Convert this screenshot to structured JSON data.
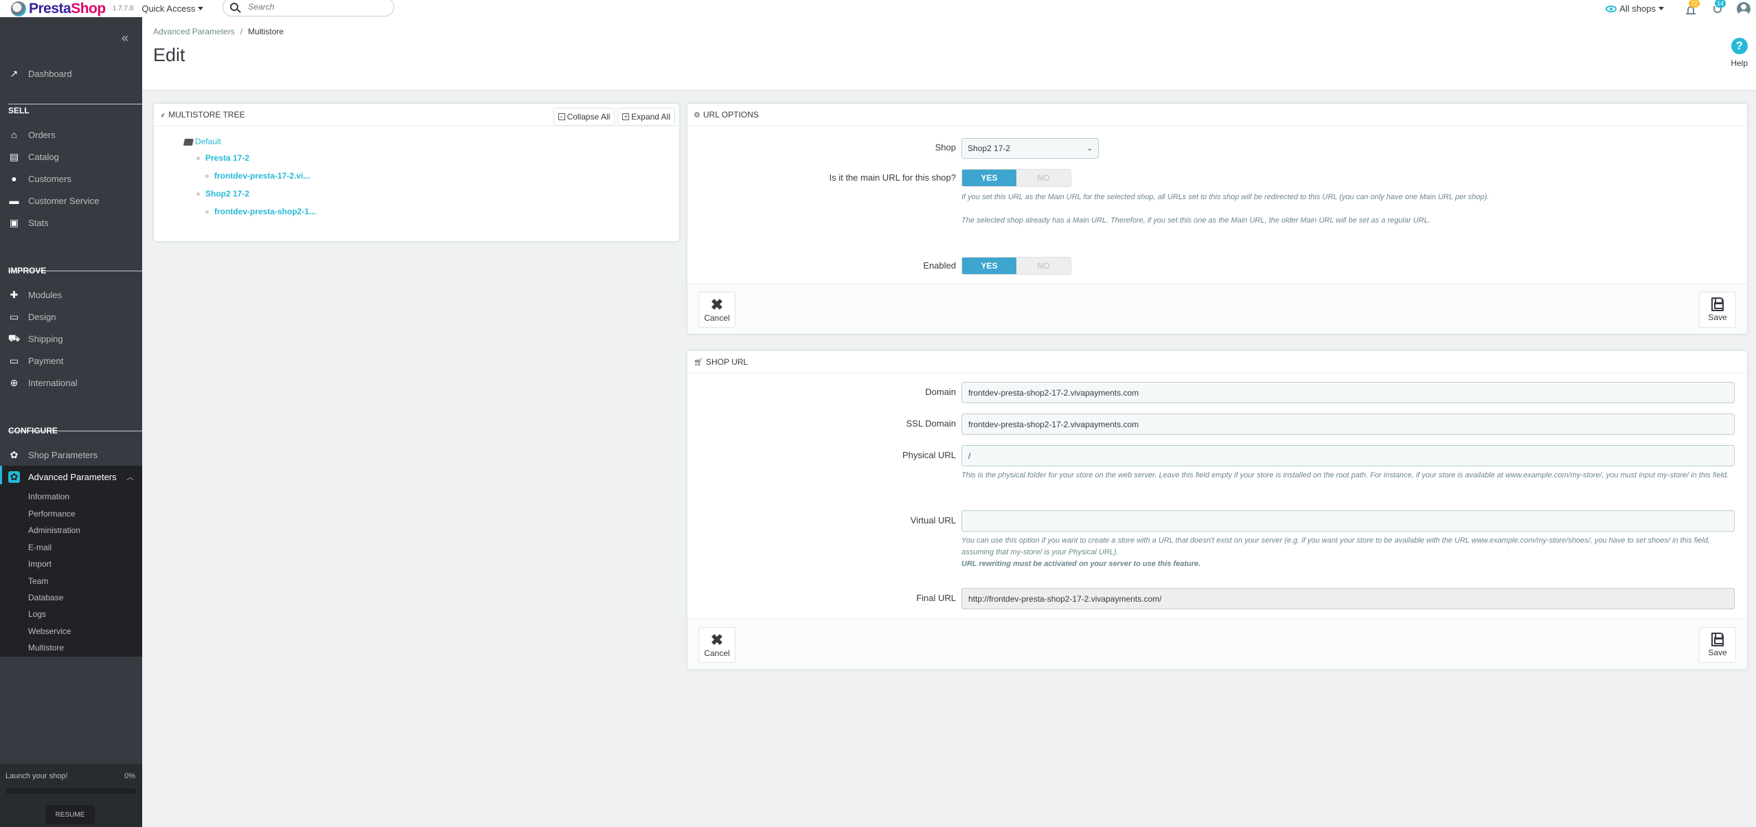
{
  "header": {
    "brand": {
      "part1": "Presta",
      "part2": "Shop"
    },
    "version": "1.7.7.8",
    "quick_access": "Quick Access",
    "search": {
      "placeholder": "Search",
      "value": ""
    },
    "shop_context": "All shops",
    "notifications": {
      "orders_count": "72",
      "messages_count": "14"
    }
  },
  "sidebar": {
    "dashboard": "Dashboard",
    "sections": [
      {
        "title": "SELL",
        "items": [
          "Orders",
          "Catalog",
          "Customers",
          "Customer Service",
          "Stats"
        ]
      },
      {
        "title": "IMPROVE",
        "items": [
          "Modules",
          "Design",
          "Shipping",
          "Payment",
          "International"
        ]
      },
      {
        "title": "CONFIGURE",
        "items": [
          "Shop Parameters",
          "Advanced Parameters"
        ]
      }
    ],
    "active_item": "Advanced Parameters",
    "submenu": [
      "Information",
      "Performance",
      "Administration",
      "E-mail",
      "Import",
      "Team",
      "Database",
      "Logs",
      "Webservice",
      "Multistore"
    ],
    "launch": {
      "label": "Launch your shop!",
      "percent_text": "0%",
      "progress": 0,
      "resume": "RESUME"
    }
  },
  "page": {
    "breadcrumb": [
      "Advanced Parameters",
      "Multistore"
    ],
    "title": "Edit",
    "help": "Help"
  },
  "tree": {
    "title": "MULTISTORE TREE",
    "collapse_all": "Collapse All",
    "expand_all": "Expand All",
    "group": "Default",
    "shops": [
      {
        "name": "Presta 17-2",
        "url": "frontdev-presta-17-2.vi..."
      },
      {
        "name": "Shop2 17-2",
        "url": "frontdev-presta-shop2-1..."
      }
    ]
  },
  "url_options": {
    "title": "URL OPTIONS",
    "shop_label": "Shop",
    "shop_value": "Shop2 17-2",
    "main_label": "Is it the main URL for this shop?",
    "main_value": "YES",
    "yes": "YES",
    "no": "NO",
    "main_help_1": "If you set this URL as the Main URL for the selected shop, all URLs set to this shop will be redirected to this URL (you can only have one Main URL per shop).",
    "main_help_2": "The selected shop already has a Main URL. Therefore, if you set this one as the Main URL, the older Main URL will be set as a regular URL.",
    "enabled_label": "Enabled",
    "enabled_value": "YES",
    "cancel": "Cancel",
    "save": "Save"
  },
  "shop_url": {
    "title": "SHOP URL",
    "domain_label": "Domain",
    "domain_value": "frontdev-presta-shop2-17-2.vivapayments.com",
    "ssl_label": "SSL Domain",
    "ssl_value": "frontdev-presta-shop2-17-2.vivapayments.com",
    "physical_label": "Physical URL",
    "physical_value": "/",
    "physical_help": "This is the physical folder for your store on the web server. Leave this field empty if your store is installed on the root path. For instance, if your store is available at www.example.com/my-store/, you must input my-store/ in this field.",
    "virtual_label": "Virtual URL",
    "virtual_value": "",
    "virtual_help": "You can use this option if you want to create a store with a URL that doesn't exist on your server (e.g. if you want your store to be available with the URL www.example.com/my-store/shoes/, you have to set shoes/ in this field, assuming that my-store/ is your Physical URL).",
    "virtual_help_bold": "URL rewriting must be activated on your server to use this feature.",
    "final_label": "Final URL",
    "final_value": "http://frontdev-presta-shop2-17-2.vivapayments.com/",
    "cancel": "Cancel",
    "save": "Save"
  }
}
